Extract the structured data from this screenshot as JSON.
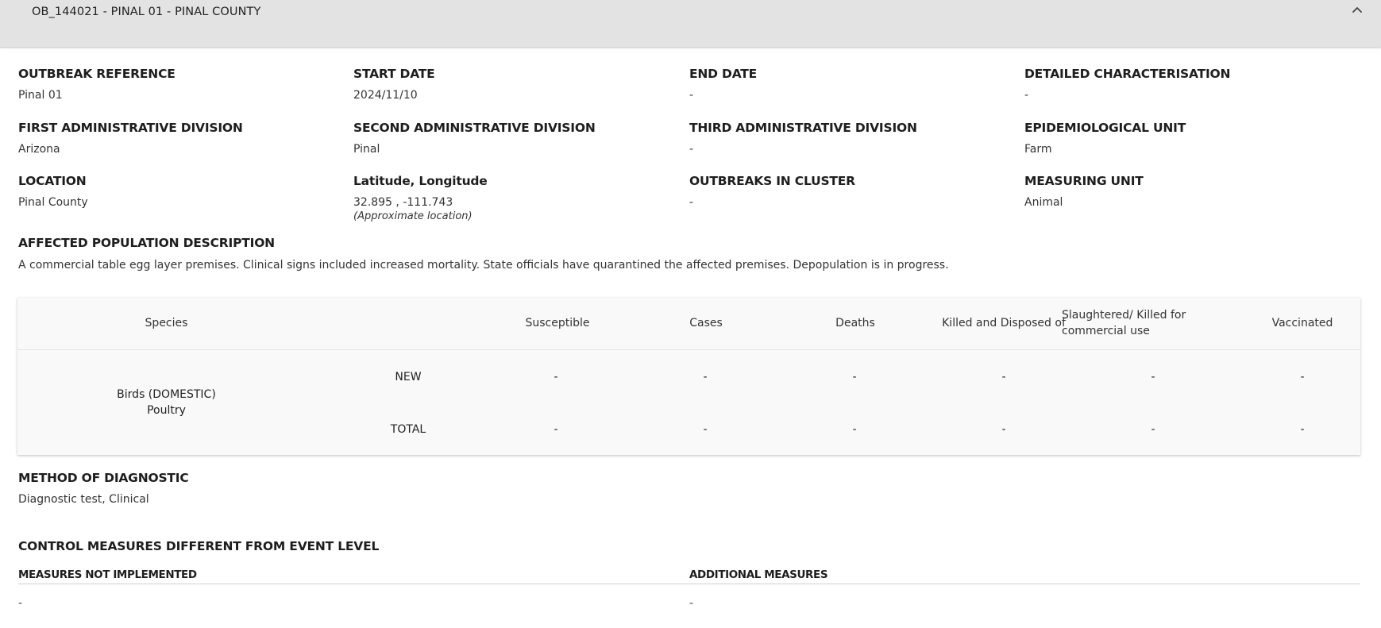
{
  "header": {
    "title": "OB_144021 - PINAL 01 - PINAL COUNTY",
    "collapse_icon": "chevron-up-icon"
  },
  "fields": {
    "outbreak_reference": {
      "label": "OUTBREAK REFERENCE",
      "value": "Pinal 01"
    },
    "start_date": {
      "label": "START DATE",
      "value": "2024/11/10"
    },
    "end_date": {
      "label": "END DATE",
      "value": "-"
    },
    "detailed_characterisation": {
      "label": "DETAILED CHARACTERISATION",
      "value": "-"
    },
    "first_admin": {
      "label": "FIRST ADMINISTRATIVE DIVISION",
      "value": "Arizona"
    },
    "second_admin": {
      "label": "SECOND ADMINISTRATIVE DIVISION",
      "value": "Pinal"
    },
    "third_admin": {
      "label": "THIRD ADMINISTRATIVE DIVISION",
      "value": "-"
    },
    "epi_unit": {
      "label": "EPIDEMIOLOGICAL UNIT",
      "value": "Farm"
    },
    "location": {
      "label": "LOCATION",
      "value": "Pinal County"
    },
    "lat_long": {
      "label": "Latitude, Longitude",
      "value": "32.895 , -111.743",
      "note": "(Approximate location)"
    },
    "outbreaks_in_cluster": {
      "label": "OUTBREAKS IN CLUSTER",
      "value": "-"
    },
    "measuring_unit": {
      "label": "MEASURING UNIT",
      "value": "Animal"
    }
  },
  "affected_population": {
    "label": "AFFECTED POPULATION DESCRIPTION",
    "text": "A commercial table egg layer premises. Clinical signs included increased mortality. State officials have quarantined the affected premises. Depopulation is in progress."
  },
  "table": {
    "headers": {
      "species": "Species",
      "susceptible": "Susceptible",
      "cases": "Cases",
      "deaths": "Deaths",
      "killed": "Killed and Disposed of",
      "slaughtered_1": "Slaughtered/ Killed for",
      "slaughtered_2": "commercial use",
      "vaccinated": "Vaccinated"
    },
    "species_line1": "Birds (DOMESTIC)",
    "species_line2": "Poultry",
    "rows": [
      {
        "type": "NEW",
        "susceptible": "-",
        "cases": "-",
        "deaths": "-",
        "killed": "-",
        "slaughtered": "-",
        "vaccinated": "-"
      },
      {
        "type": "TOTAL",
        "susceptible": "-",
        "cases": "-",
        "deaths": "-",
        "killed": "-",
        "slaughtered": "-",
        "vaccinated": "-"
      }
    ]
  },
  "diagnostic": {
    "label": "METHOD OF DIAGNOSTIC",
    "value": "Diagnostic test, Clinical"
  },
  "control_measures": {
    "label": "CONTROL MEASURES DIFFERENT FROM EVENT LEVEL",
    "not_implemented_label": "MEASURES NOT IMPLEMENTED",
    "not_implemented_value": "-",
    "additional_label": "ADDITIONAL MEASURES",
    "additional_value": "-"
  }
}
